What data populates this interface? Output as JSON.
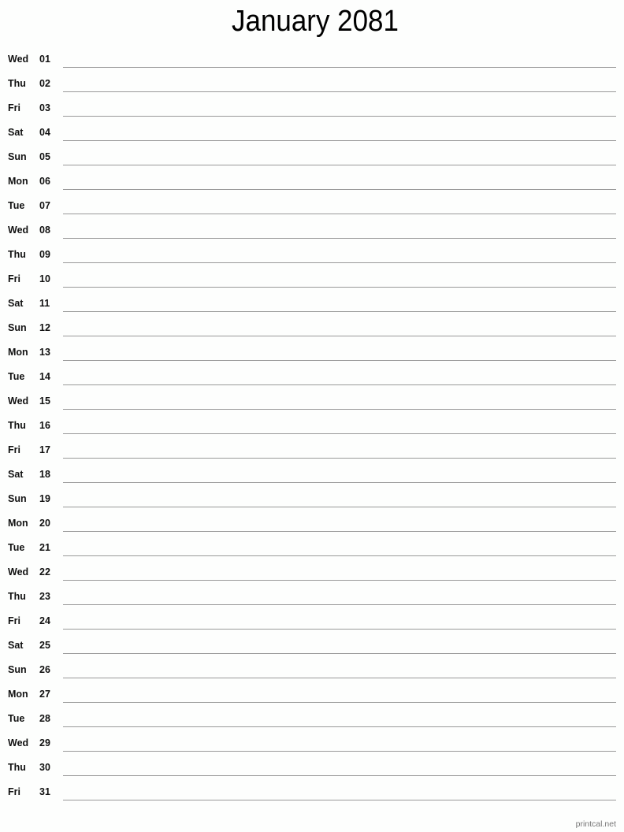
{
  "title": "January 2081",
  "days": [
    {
      "dow": "Wed",
      "num": "01"
    },
    {
      "dow": "Thu",
      "num": "02"
    },
    {
      "dow": "Fri",
      "num": "03"
    },
    {
      "dow": "Sat",
      "num": "04"
    },
    {
      "dow": "Sun",
      "num": "05"
    },
    {
      "dow": "Mon",
      "num": "06"
    },
    {
      "dow": "Tue",
      "num": "07"
    },
    {
      "dow": "Wed",
      "num": "08"
    },
    {
      "dow": "Thu",
      "num": "09"
    },
    {
      "dow": "Fri",
      "num": "10"
    },
    {
      "dow": "Sat",
      "num": "11"
    },
    {
      "dow": "Sun",
      "num": "12"
    },
    {
      "dow": "Mon",
      "num": "13"
    },
    {
      "dow": "Tue",
      "num": "14"
    },
    {
      "dow": "Wed",
      "num": "15"
    },
    {
      "dow": "Thu",
      "num": "16"
    },
    {
      "dow": "Fri",
      "num": "17"
    },
    {
      "dow": "Sat",
      "num": "18"
    },
    {
      "dow": "Sun",
      "num": "19"
    },
    {
      "dow": "Mon",
      "num": "20"
    },
    {
      "dow": "Tue",
      "num": "21"
    },
    {
      "dow": "Wed",
      "num": "22"
    },
    {
      "dow": "Thu",
      "num": "23"
    },
    {
      "dow": "Fri",
      "num": "24"
    },
    {
      "dow": "Sat",
      "num": "25"
    },
    {
      "dow": "Sun",
      "num": "26"
    },
    {
      "dow": "Mon",
      "num": "27"
    },
    {
      "dow": "Tue",
      "num": "28"
    },
    {
      "dow": "Wed",
      "num": "29"
    },
    {
      "dow": "Thu",
      "num": "30"
    },
    {
      "dow": "Fri",
      "num": "31"
    }
  ],
  "footer": "printcal.net"
}
